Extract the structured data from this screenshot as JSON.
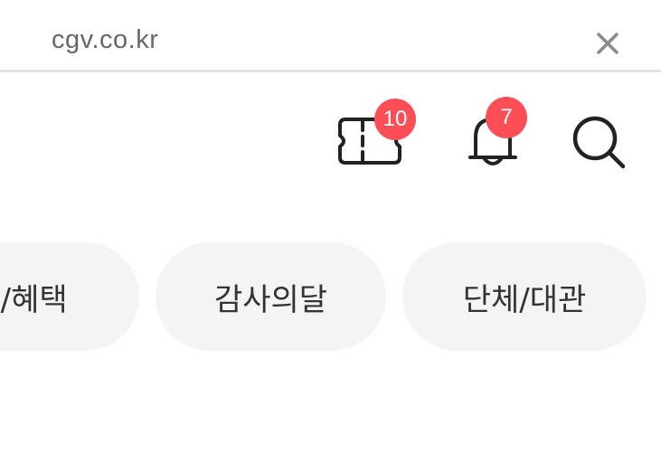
{
  "browser": {
    "url": "cgv.co.kr"
  },
  "header": {
    "ticket_badge": "10",
    "notification_badge": "7",
    "badge_color": "#fb4e57"
  },
  "chips": [
    {
      "label": "트/혜택"
    },
    {
      "label": "감사의달"
    },
    {
      "label": "단체/대관"
    }
  ]
}
